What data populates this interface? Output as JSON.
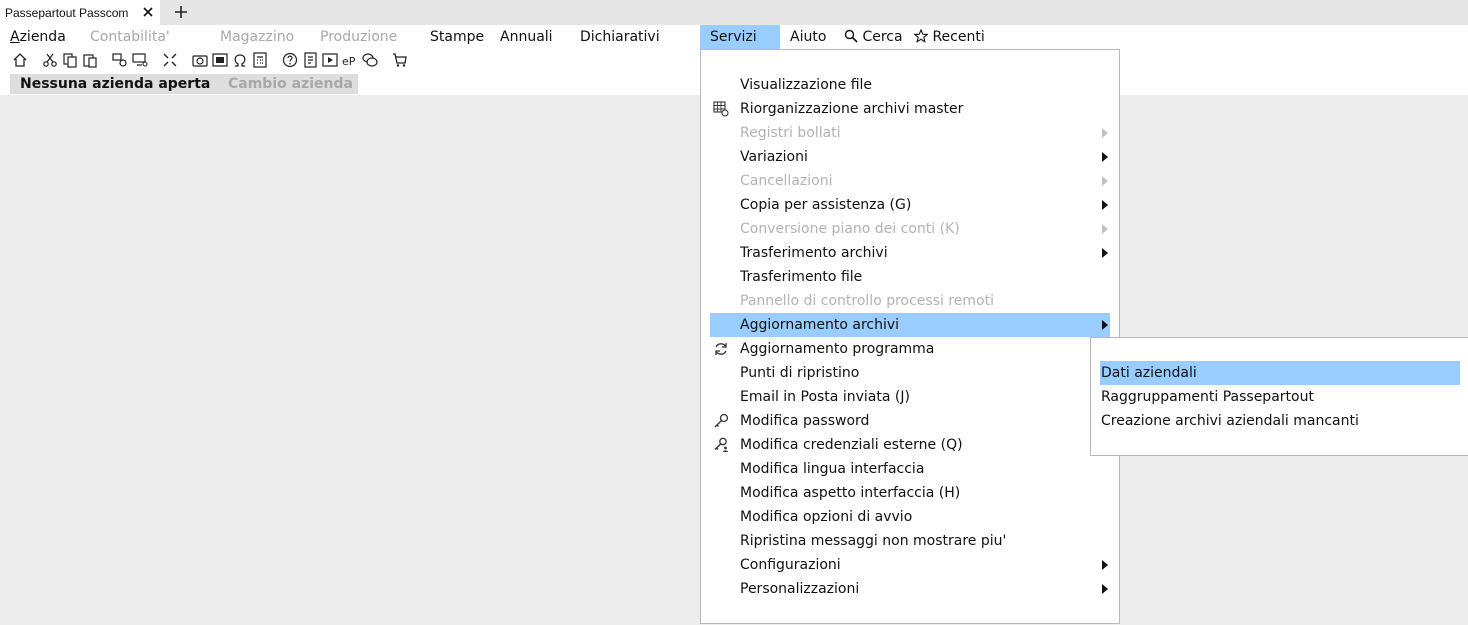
{
  "window": {
    "tab_title": "Passepartout Passcom"
  },
  "menubar": {
    "items": [
      {
        "label": "Azienda",
        "disabled": false
      },
      {
        "label": "Contabilita'",
        "disabled": true
      },
      {
        "label": "Magazzino",
        "disabled": true
      },
      {
        "label": "Produzione",
        "disabled": true
      },
      {
        "label": "Stampe",
        "disabled": false
      },
      {
        "label": "Annuali",
        "disabled": false
      },
      {
        "label": "Dichiarativi",
        "disabled": false
      },
      {
        "label": "Servizi",
        "disabled": false,
        "active": true
      },
      {
        "label": "Aiuto",
        "disabled": false
      }
    ],
    "search_label": "Cerca",
    "recent_label": "Recenti"
  },
  "company_tabs": {
    "current": "Nessuna azienda aperta",
    "change": "Cambio azienda"
  },
  "servizi_menu": {
    "items": [
      {
        "label": "Visualizzazione file",
        "disabled": false,
        "submenu": false
      },
      {
        "label": "Riorganizzazione archivi master",
        "disabled": false,
        "submenu": false,
        "icon": "table-settings-icon"
      },
      {
        "label": "Registri bollati",
        "disabled": true,
        "submenu": true
      },
      {
        "label": "Variazioni",
        "disabled": false,
        "submenu": true
      },
      {
        "label": "Cancellazioni",
        "disabled": true,
        "submenu": true
      },
      {
        "label": "Copia per assistenza (G)",
        "disabled": false,
        "submenu": true
      },
      {
        "label": "Conversione piano dei conti (K)",
        "disabled": true,
        "submenu": true
      },
      {
        "label": "Trasferimento archivi",
        "disabled": false,
        "submenu": true
      },
      {
        "label": "Trasferimento file",
        "disabled": false,
        "submenu": false
      },
      {
        "label": "Pannello di controllo processi remoti",
        "disabled": true,
        "submenu": false
      },
      {
        "label": "Aggiornamento archivi",
        "disabled": false,
        "submenu": true,
        "highlighted": true
      },
      {
        "label": "Aggiornamento programma",
        "disabled": false,
        "submenu": false,
        "icon": "refresh-icon"
      },
      {
        "label": "Punti di ripristino",
        "disabled": false,
        "submenu": false
      },
      {
        "label": "Email in Posta inviata (J)",
        "disabled": false,
        "submenu": false
      },
      {
        "label": "Modifica password",
        "disabled": false,
        "submenu": false,
        "icon": "key-icon"
      },
      {
        "label": "Modifica credenziali esterne (Q)",
        "disabled": false,
        "submenu": false,
        "icon": "key-user-icon"
      },
      {
        "label": "Modifica lingua interfaccia",
        "disabled": false,
        "submenu": false
      },
      {
        "label": "Modifica aspetto interfaccia (H)",
        "disabled": false,
        "submenu": false
      },
      {
        "label": "Modifica opzioni di avvio",
        "disabled": false,
        "submenu": false
      },
      {
        "label": "Ripristina messaggi non mostrare piu'",
        "disabled": false,
        "submenu": false
      },
      {
        "label": "Configurazioni",
        "disabled": false,
        "submenu": true
      },
      {
        "label": "Personalizzazioni",
        "disabled": false,
        "submenu": true
      }
    ]
  },
  "aggiornamento_submenu": {
    "items": [
      {
        "label": "Dati aziendali",
        "highlighted": true
      },
      {
        "label": "Raggruppamenti Passepartout",
        "highlighted": false
      },
      {
        "label": "Creazione archivi aziendali mancanti",
        "highlighted": false
      }
    ]
  },
  "colors": {
    "highlight": "#99ccff",
    "disabled_text": "#a8a8a8",
    "background": "#ececec"
  }
}
